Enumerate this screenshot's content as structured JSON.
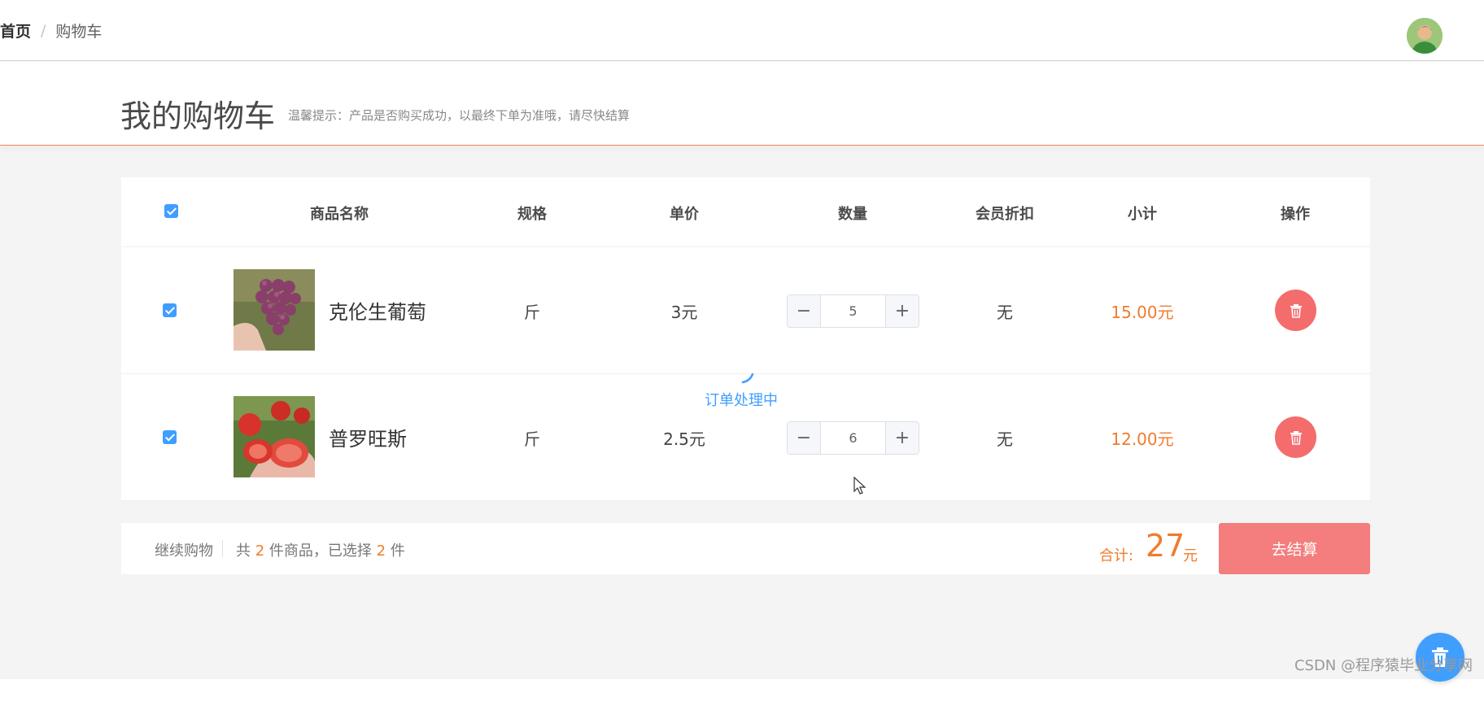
{
  "breadcrumb": {
    "home": "首页",
    "separator": "/",
    "current": "购物车"
  },
  "header": {
    "title": "我的购物车",
    "tip": "温馨提示：产品是否购买成功，以最终下单为准哦，请尽快结算"
  },
  "table": {
    "columns": [
      "商品名称",
      "规格",
      "单价",
      "数量",
      "会员折扣",
      "小计",
      "操作"
    ],
    "select_all_checked": true,
    "rows": [
      {
        "checked": true,
        "image_icon": "grapes-photo",
        "name": "克伦生葡萄",
        "spec": "斤",
        "price": "3元",
        "quantity": "5",
        "discount": "无",
        "subtotal": "15.00元"
      },
      {
        "checked": true,
        "image_icon": "tomato-photo",
        "name": "普罗旺斯",
        "spec": "斤",
        "price": "2.5元",
        "quantity": "6",
        "discount": "无",
        "subtotal": "12.00元"
      }
    ]
  },
  "loading": {
    "text": "订单处理中"
  },
  "footer": {
    "continue_label": "继续购物",
    "count_prefix": "共",
    "total_items": "2",
    "count_middle": "件商品，已选择",
    "selected_items": "2",
    "count_suffix": "件",
    "total_label": "合计:",
    "total_value": "27",
    "total_unit": "元",
    "checkout_label": "去结算"
  },
  "watermark": "CSDN @程序猿毕业分享网",
  "colors": {
    "primary": "#409eff",
    "accent": "#f07b2c",
    "danger": "#f56c6c",
    "checkout": "#f47d7d"
  }
}
